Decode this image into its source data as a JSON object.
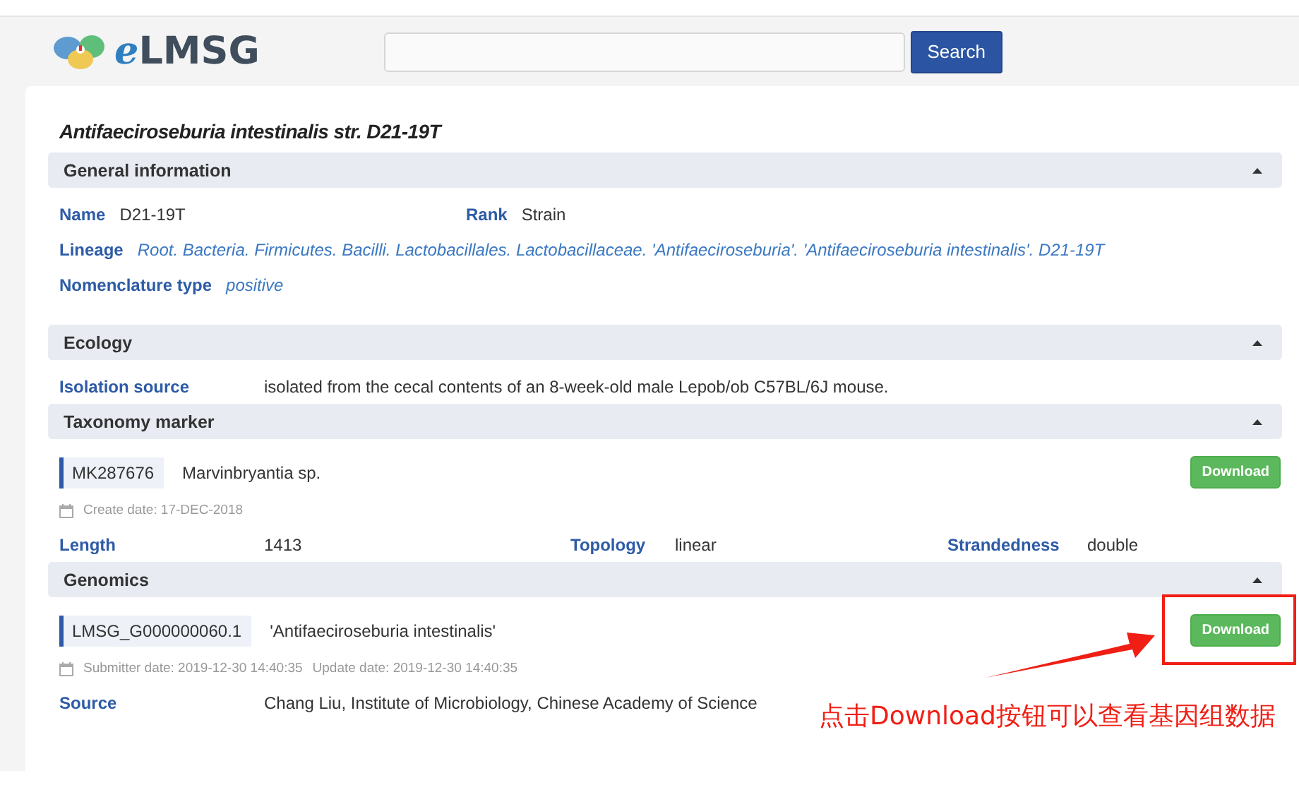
{
  "header": {
    "logo": {
      "prefix": "e",
      "name": "LMSG"
    },
    "search_button": "Search"
  },
  "title": "Antifaeciroseburia intestinalis str. D21-19T",
  "sections": [
    {
      "title": "General information",
      "expanded": true,
      "items": [
        {
          "kind": "pairs",
          "fields": [
            {
              "label": "Name",
              "value": "D21-19T",
              "italic": false
            },
            {
              "label": "Rank",
              "value": "Strain",
              "italic": false
            }
          ]
        },
        {
          "kind": "pairs",
          "fields": [
            {
              "label": "Lineage",
              "value": "Root. Bacteria. Firmicutes. Bacilli. Lactobacillales. Lactobacillaceae. 'Antifaeciroseburia'. 'Antifaeciroseburia intestinalis'. D21-19T",
              "italic": true
            }
          ]
        },
        {
          "kind": "pairs",
          "fields": [
            {
              "label": "Nomenclature type",
              "value": "positive",
              "italic": true
            }
          ]
        }
      ]
    },
    {
      "title": "Ecology",
      "expanded": true,
      "items": [
        {
          "kind": "grid",
          "fields": [
            {
              "label": "Isolation source",
              "value": "isolated from the cecal contents of an 8-week-old male Lepob/ob C57BL/6J mouse.",
              "italic": false
            }
          ]
        }
      ]
    },
    {
      "title": "Taxonomy marker",
      "expanded": true,
      "items": [
        {
          "kind": "record",
          "id": "MK287676",
          "description": "Marvinbryantia sp.",
          "button": "Download",
          "dates": [
            "Create date: 17-DEC-2018"
          ]
        },
        {
          "kind": "grid",
          "fields": [
            {
              "label": "Length",
              "value": "1413",
              "italic": false
            },
            {
              "label": "Topology",
              "value": "linear",
              "italic": false
            },
            {
              "label": "Strandedness",
              "value": "double",
              "italic": false
            }
          ]
        }
      ]
    },
    {
      "title": "Genomics",
      "expanded": true,
      "items": [
        {
          "kind": "record",
          "id": "LMSG_G000000060.1",
          "description": "'Antifaeciroseburia intestinalis'",
          "button": "Download",
          "dates": [
            "Submitter date: 2019-12-30 14:40:35",
            "Update date: 2019-12-30 14:40:35"
          ]
        },
        {
          "kind": "grid",
          "fields": [
            {
              "label": "Source",
              "value": "Chang Liu, Institute of Microbiology, Chinese Academy of Science",
              "italic": false
            }
          ]
        }
      ]
    }
  ],
  "annotation": {
    "note": "点击Download按钮可以查看基因组数据"
  }
}
